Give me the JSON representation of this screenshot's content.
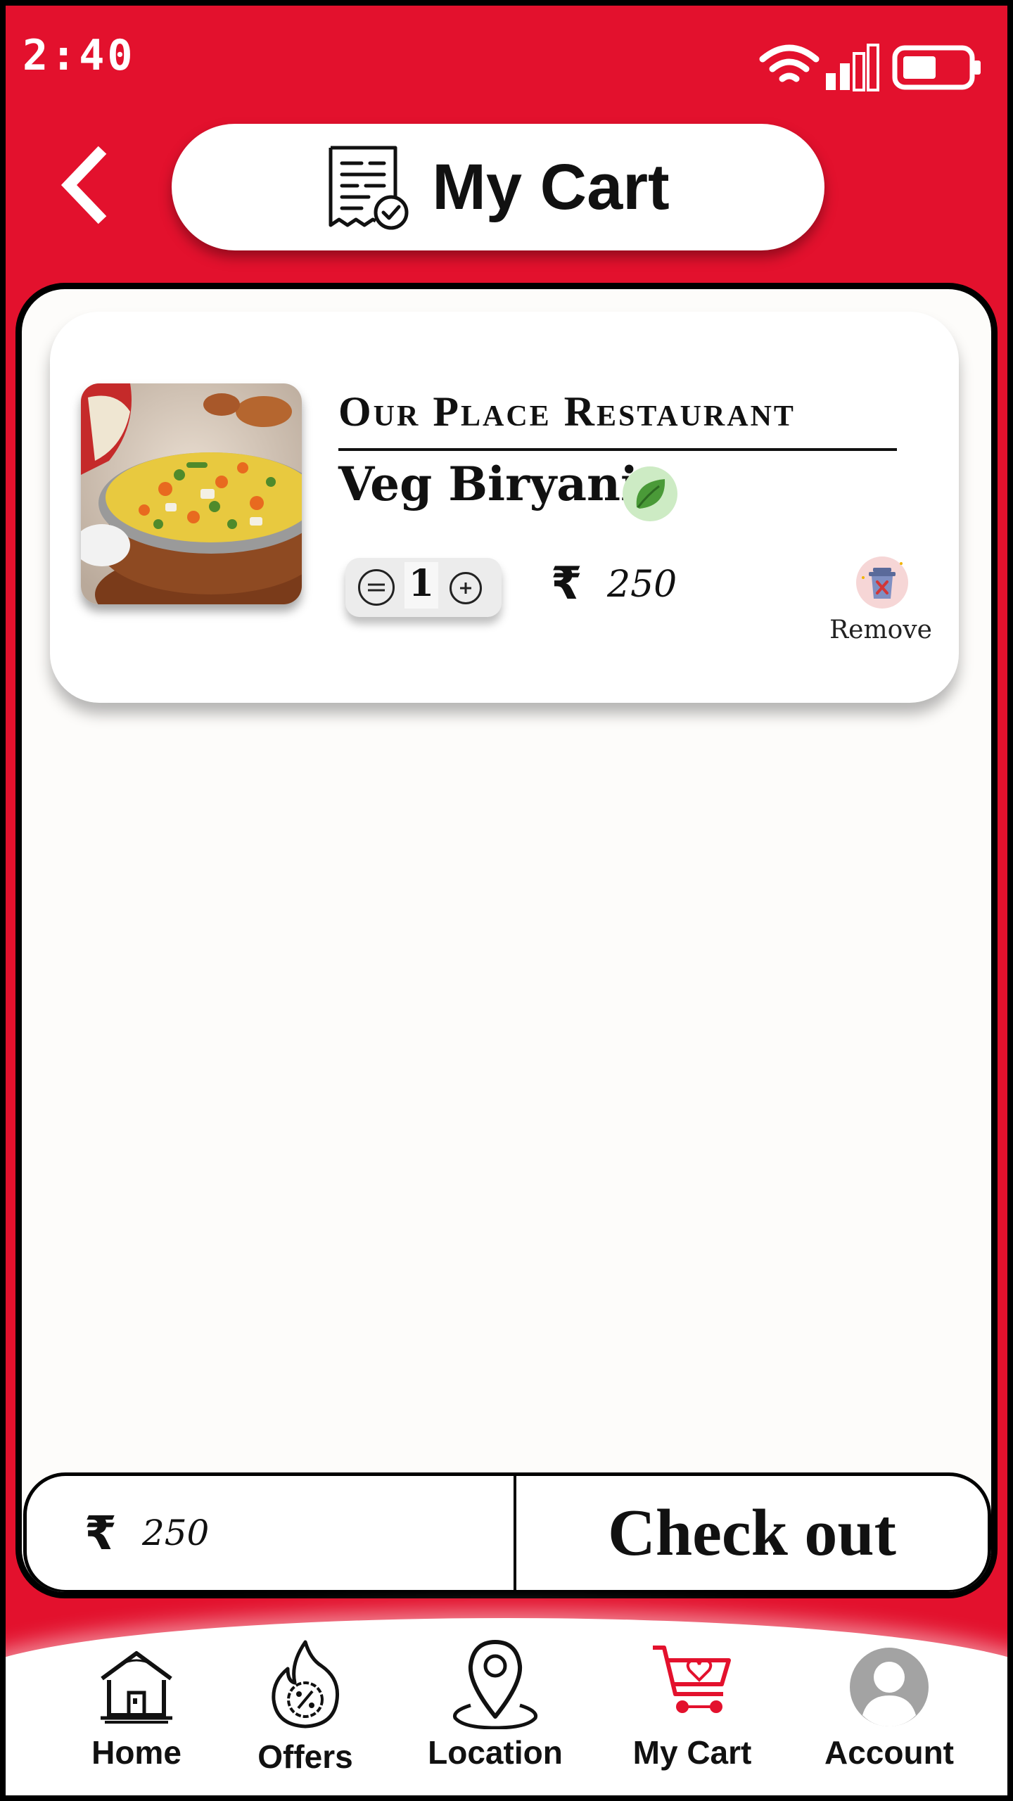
{
  "status_bar": {
    "time": "2:40"
  },
  "header": {
    "title": "My Cart"
  },
  "cart": {
    "items": [
      {
        "restaurant": "Our Place Restaurant",
        "name": "Veg Biryani",
        "quantity": "1",
        "currency": "₹",
        "price": "250",
        "remove_label": "Remove",
        "veg_icon": "leaf-icon"
      }
    ]
  },
  "checkout": {
    "currency": "₹",
    "total": "250",
    "button_label": "Check out"
  },
  "nav": {
    "items": [
      {
        "label": "Home",
        "icon": "home-icon"
      },
      {
        "label": "Offers",
        "icon": "offers-icon"
      },
      {
        "label": "Location",
        "icon": "location-pin-icon"
      },
      {
        "label": "My Cart",
        "icon": "cart-icon",
        "active": true
      },
      {
        "label": "Account",
        "icon": "account-icon"
      }
    ]
  },
  "colors": {
    "primary": "#e3112d",
    "veg_green": "#4a9a38",
    "active_nav": "#e3112d",
    "account_grey": "#a3a3a3"
  }
}
